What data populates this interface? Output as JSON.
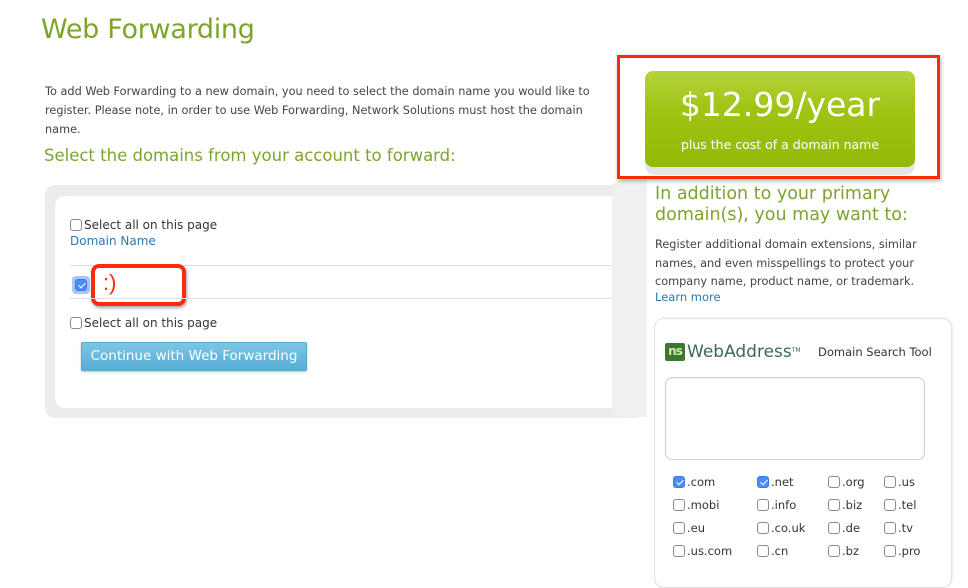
{
  "page": {
    "title": "Web Forwarding",
    "intro": "To add Web Forwarding to a new domain, you need to select the domain name you would like to register. Please note, in order to use Web Forwarding, Network Solutions must host the domain name.",
    "section_title": "Select the domains from your account to forward:"
  },
  "domains_panel": {
    "select_all_label": "Select all on this page",
    "select_all_checked": false,
    "column_header": "Domain Name",
    "rows": [
      {
        "name": ":)",
        "checked": true
      }
    ],
    "select_all_bottom_label": "Select all on this page",
    "continue_button": "Continue with Web Forwarding"
  },
  "price": {
    "amount": "$12.99/year",
    "subtitle": "plus the cost of a domain name"
  },
  "sidebar": {
    "title": "In addition to your primary domain(s), you may want to:",
    "text": "Register additional domain extensions, similar names, and even misspellings to protect your company name, product name, or trademark.",
    "learn_more": "Learn more"
  },
  "search_widget": {
    "logo_mark": "ns",
    "logo_text": "WebAddress",
    "logo_tm": "TM",
    "tool_label": "Domain Search Tool",
    "search_value": "",
    "tlds": [
      {
        "label": ".com",
        "checked": true
      },
      {
        "label": ".net",
        "checked": true
      },
      {
        "label": ".org",
        "checked": false
      },
      {
        "label": ".us",
        "checked": false
      },
      {
        "label": ".mobi",
        "checked": false
      },
      {
        "label": ".info",
        "checked": false
      },
      {
        "label": ".biz",
        "checked": false
      },
      {
        "label": ".tel",
        "checked": false
      },
      {
        "label": ".eu",
        "checked": false
      },
      {
        "label": ".co.uk",
        "checked": false
      },
      {
        "label": ".de",
        "checked": false
      },
      {
        "label": ".tv",
        "checked": false
      },
      {
        "label": ".us.com",
        "checked": false
      },
      {
        "label": ".cn",
        "checked": false
      },
      {
        "label": ".bz",
        "checked": false
      },
      {
        "label": ".pro",
        "checked": false
      }
    ]
  },
  "colors": {
    "brand_green": "#7ea42b",
    "price_green": "#9fc414",
    "link_blue": "#2a7ab0",
    "button_blue": "#56add5",
    "annotation_red": "#ff2a0c",
    "checkbox_blue": "#4c8df5"
  }
}
